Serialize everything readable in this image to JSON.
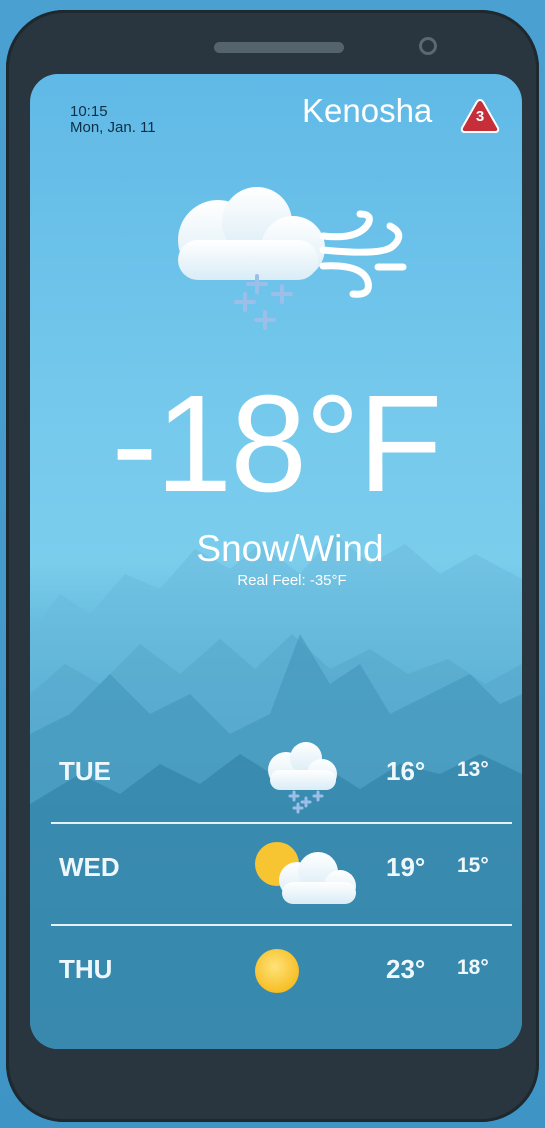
{
  "status": {
    "time": "10:15",
    "date": "Mon, Jan. 11"
  },
  "location": {
    "city": "Kenosha",
    "alert_count": "3"
  },
  "current": {
    "icon": "snow-wind-icon",
    "temperature": "-18°F",
    "condition": "Snow/Wind",
    "real_feel": "Real Feel: -35°F"
  },
  "forecast": [
    {
      "day": "TUE",
      "icon": "cloud-snow-icon",
      "high": "16°",
      "low": "13°"
    },
    {
      "day": "WED",
      "icon": "partly-cloudy-icon",
      "high": "19°",
      "low": "15°"
    },
    {
      "day": "THU",
      "icon": "sun-icon",
      "high": "23°",
      "low": "18°"
    }
  ],
  "colors": {
    "sky_top": "#60b9e6",
    "sky_bottom": "#22617f",
    "alert": "#c62f3a",
    "phone": "#29363f"
  }
}
